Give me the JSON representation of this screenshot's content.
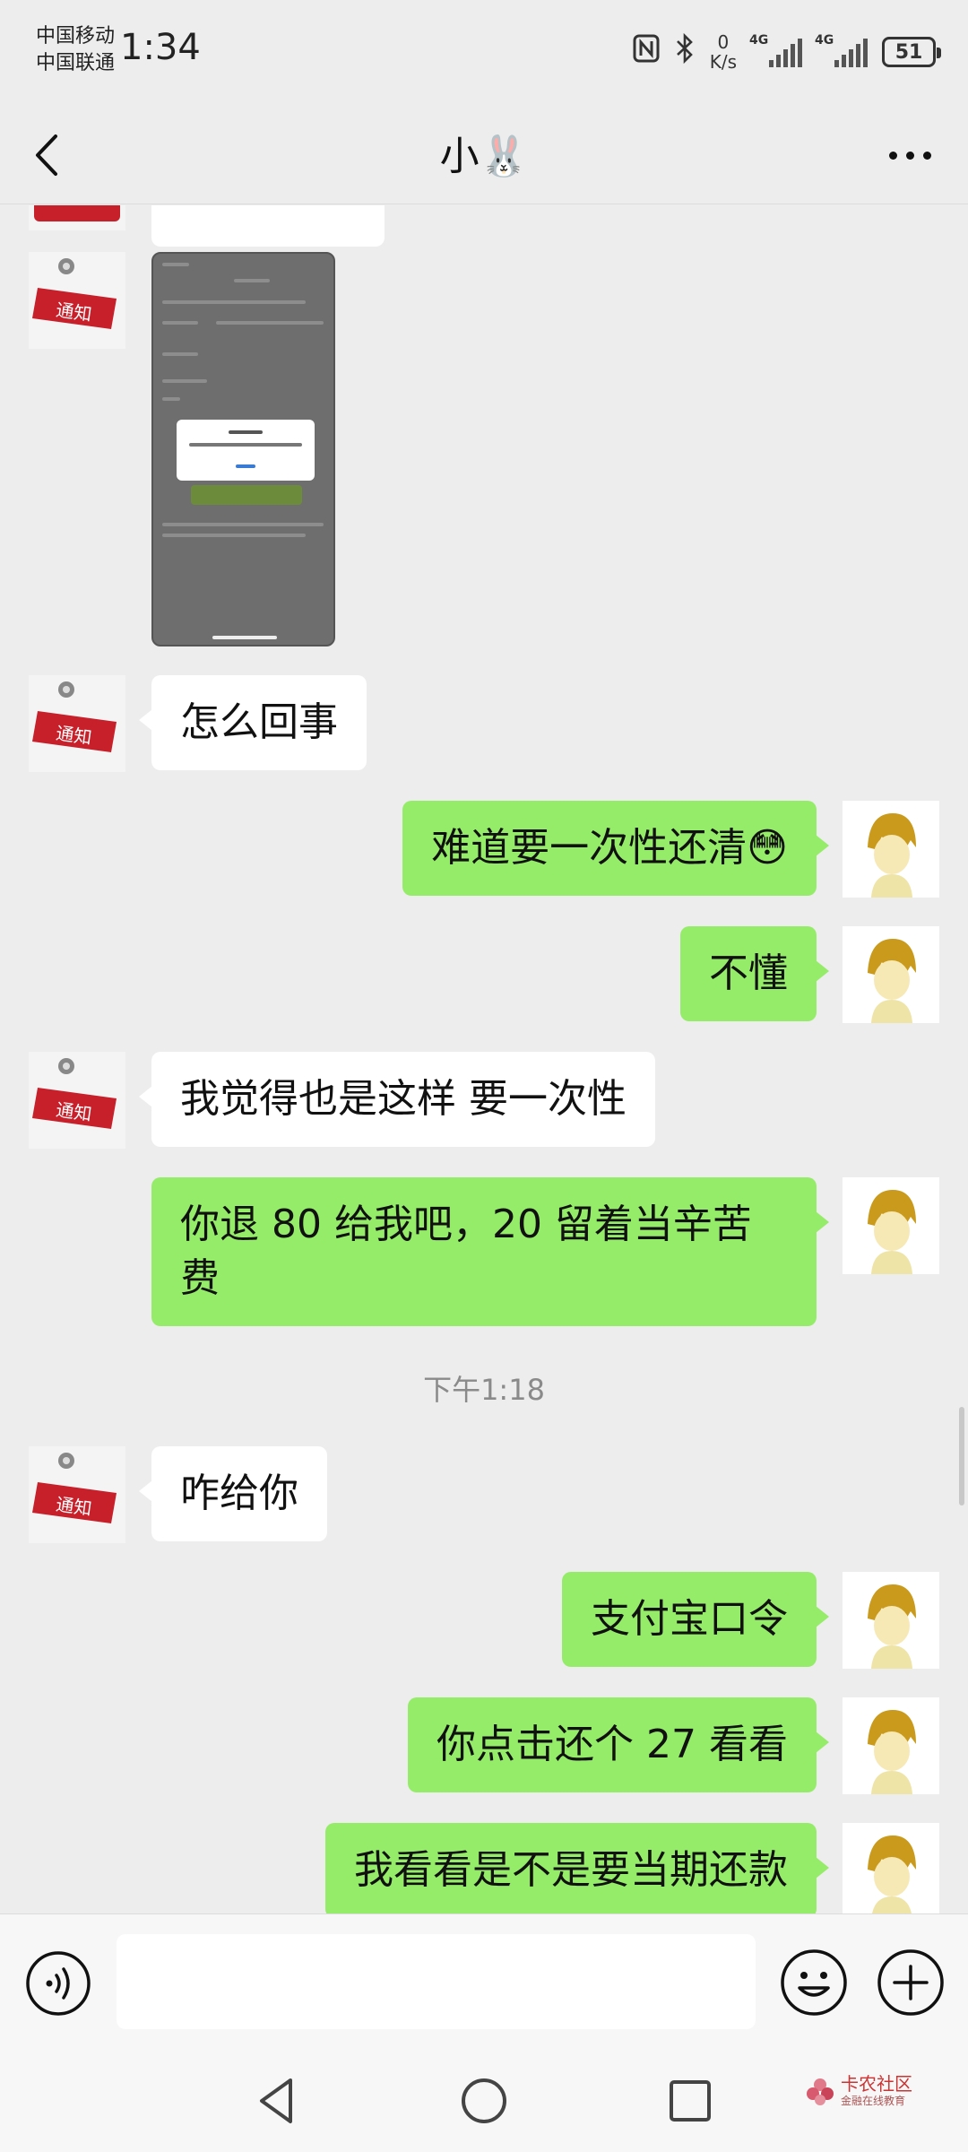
{
  "status_bar": {
    "carrier1": "中国移动",
    "carrier2": "中国联通",
    "time": "1:34",
    "net_speed_value": "0",
    "net_speed_unit": "K/s",
    "signal1_label": "4G",
    "signal2_label": "4G",
    "battery": "51"
  },
  "header": {
    "title": "小🐰"
  },
  "messages": [
    {
      "side": "left",
      "text": "怎么回事"
    },
    {
      "side": "right",
      "text": "难道要一次性还清😳"
    },
    {
      "side": "right",
      "text": "不懂"
    },
    {
      "side": "left",
      "text": "我觉得也是这样 要一次性"
    },
    {
      "side": "right",
      "text": "你退 80 给我吧，20 留着当辛苦费"
    },
    {
      "side": "left",
      "text": "咋给你"
    },
    {
      "side": "right",
      "text": "支付宝口令"
    },
    {
      "side": "right",
      "text": "你点击还个 27 看看"
    },
    {
      "side": "right",
      "text": "我看看是不是要当期还款"
    }
  ],
  "timestamp": "下午1:18",
  "avatar_labels": {
    "left": "通知"
  },
  "watermark": {
    "main": "卡农社区",
    "sub": "金融在线教育"
  },
  "colors": {
    "bubble_green": "#95ec69",
    "background": "#ededed"
  }
}
